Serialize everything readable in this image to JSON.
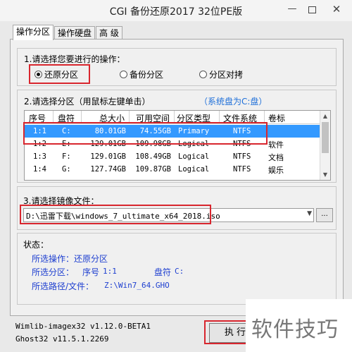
{
  "window": {
    "title": "CGI 备份还原2017 32位PE版",
    "minimize": "—",
    "close": "✕"
  },
  "tabs": [
    "操作分区",
    "操作硬盘",
    "高 级"
  ],
  "step1": {
    "label": "1.请选择您要进行的操作：",
    "options": [
      {
        "label": "还原分区",
        "checked": true
      },
      {
        "label": "备份分区",
        "checked": false
      },
      {
        "label": "分区对拷",
        "checked": false
      }
    ]
  },
  "step2": {
    "label": "2.请选择分区（用鼠标左键单击）",
    "system_note": "（系统盘为C:盘）",
    "columns": [
      "序号",
      "盘符",
      "总大小",
      "可用空间",
      "分区类型",
      "文件系统",
      "卷标"
    ],
    "rows": [
      [
        "1:1",
        "C:",
        "80.01GB",
        "74.55GB",
        "Primary",
        "NTFS",
        ""
      ],
      [
        "1:2",
        "E:",
        "129.01GB",
        "109.98GB",
        "Logical",
        "NTFS",
        "软件"
      ],
      [
        "1:3",
        "F:",
        "129.01GB",
        "108.49GB",
        "Logical",
        "NTFS",
        "文档"
      ],
      [
        "1:4",
        "G:",
        "127.74GB",
        "109.87GB",
        "Logical",
        "NTFS",
        "娱乐"
      ]
    ],
    "selected_row": 0
  },
  "step3": {
    "label": "3.请选择镜像文件：",
    "value": "D:\\迅雷下载\\windows_7_ultimate_x64_2018.iso",
    "browse": "..."
  },
  "status": {
    "title": "状态：",
    "op_label": "所选操作：",
    "op_value": "还原分区",
    "part_label": "所选分区：",
    "part_num_label": "序号",
    "part_num": "1:1",
    "drive_label": "盘符",
    "drive": "C:",
    "path_label": "所选路径/文件：",
    "path": "Z:\\Win7_64.GHO"
  },
  "footer": {
    "line1": "Wimlib-imagex32 v1.12.0-BETA1",
    "line2": "Ghost32 v11.5.1.2269"
  },
  "execute": "执 行",
  "watermark": "软件技巧",
  "colors": {
    "highlight": "#d8262e",
    "selection": "#3399ff",
    "note": "#1e6fd9"
  }
}
